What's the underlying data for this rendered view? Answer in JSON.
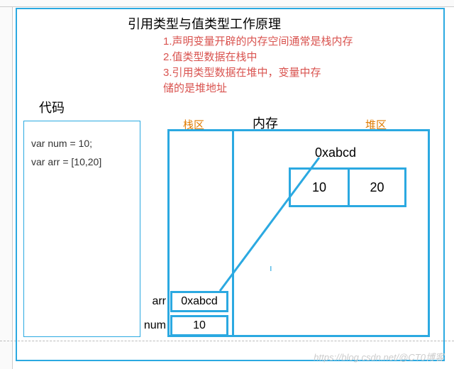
{
  "title": "引用类型与值类型工作原理",
  "notes": {
    "n1": "1.声明变量开辟的内存空间通常是栈内存",
    "n2": "2.值类型数据在栈中",
    "n3": "3.引用类型数据在堆中，变量中存",
    "n4": "储的是堆地址"
  },
  "labels": {
    "code": "代码",
    "stack": "栈区",
    "memory": "内存",
    "heap": "堆区"
  },
  "code": {
    "l1": "var num = 10;",
    "l2": "var arr = [10,20]"
  },
  "heap": {
    "addr": "0xabcd",
    "cells": [
      "10",
      "20"
    ]
  },
  "stack": {
    "arr_k": "arr",
    "arr_v": "0xabcd",
    "num_k": "num",
    "num_v": "10"
  },
  "watermark": "https://blog.csdn.net/@CT0博客"
}
